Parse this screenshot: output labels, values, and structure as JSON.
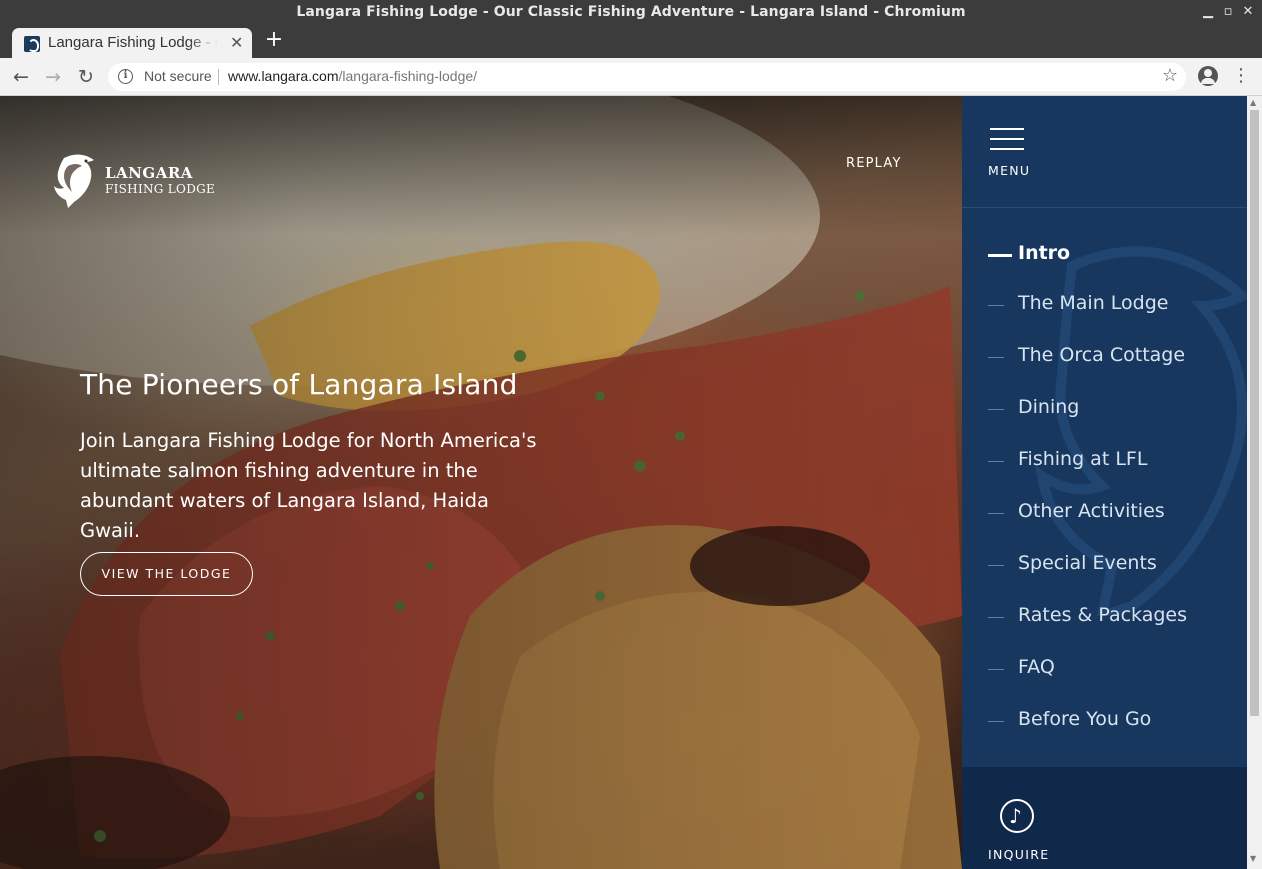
{
  "window": {
    "title": "Langara Fishing Lodge - Our Classic Fishing Adventure - Langara Island - Chromium"
  },
  "tab": {
    "title": "Langara Fishing Lodge - Our Classic Fishing Adventure",
    "close": "✕"
  },
  "toolbar": {
    "security_label": "Not secure",
    "url_host": "www.langara.com",
    "url_path": "/langara-fishing-lodge/"
  },
  "site": {
    "logo_name": "LANGARA",
    "logo_sub": "FISHING LODGE",
    "replay_label": "REPLAY"
  },
  "hero": {
    "headline": "The Pioneers of Langara Island",
    "lede": "Join Langara Fishing Lodge for North America's ultimate salmon fishing adventure in the abundant waters of Langara Island, Haida Gwaii.",
    "cta_label": "VIEW THE LODGE"
  },
  "sidebar": {
    "menu_label": "MENU",
    "items": [
      {
        "label": "Intro",
        "active": true
      },
      {
        "label": "The Main Lodge",
        "active": false
      },
      {
        "label": "The Orca Cottage",
        "active": false
      },
      {
        "label": "Dining",
        "active": false
      },
      {
        "label": "Fishing at LFL",
        "active": false
      },
      {
        "label": "Other Activities",
        "active": false
      },
      {
        "label": "Special Events",
        "active": false
      },
      {
        "label": "Rates & Packages",
        "active": false
      },
      {
        "label": "FAQ",
        "active": false
      },
      {
        "label": "Before You Go",
        "active": false
      }
    ],
    "inquire_label": "INQUIRE"
  },
  "colors": {
    "sidebar_bg": "#17375e",
    "inquire_bg": "#10294a",
    "accent_white": "#ffffff"
  },
  "icons": [
    "info-icon",
    "star-icon",
    "account-icon",
    "menu-burger-icon",
    "fish-logo-icon",
    "inquire-hook-icon"
  ]
}
